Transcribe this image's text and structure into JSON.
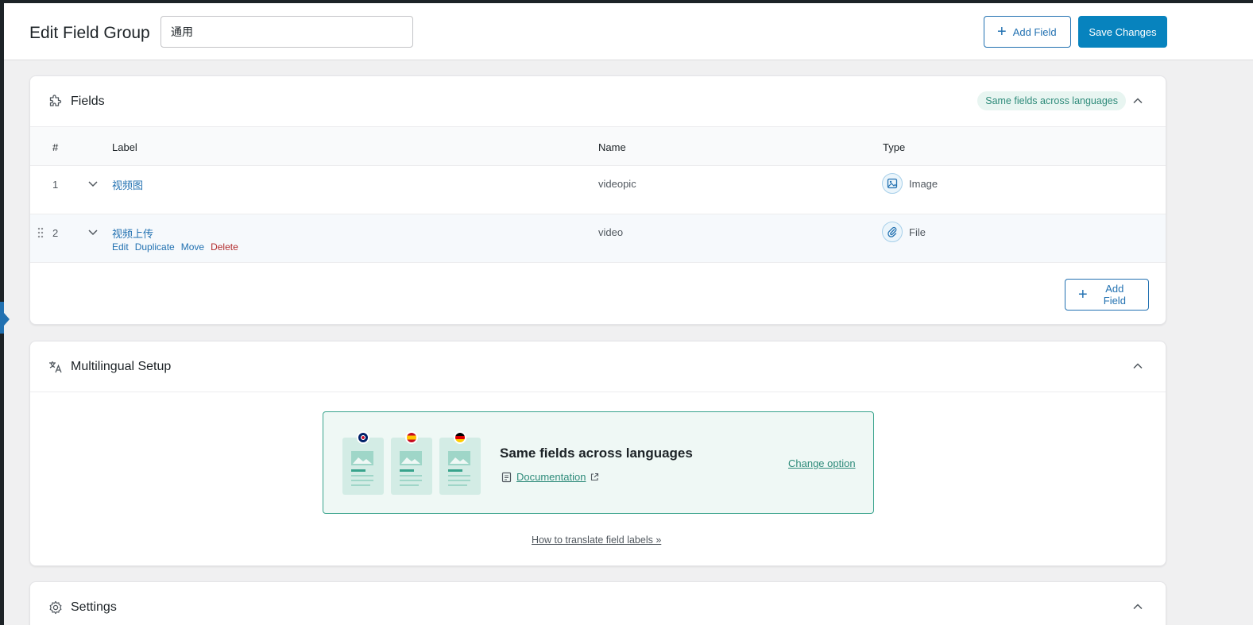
{
  "header": {
    "page_title": "Edit Field Group",
    "group_title_value": "通用",
    "add_field_label": "Add Field",
    "save_label": "Save Changes"
  },
  "fields_panel": {
    "title": "Fields",
    "badge": "Same fields across languages",
    "columns": {
      "num": "#",
      "label": "Label",
      "name": "Name",
      "type": "Type"
    },
    "rows": [
      {
        "num": "1",
        "label": "视频图",
        "name": "videopic",
        "type": "Image",
        "type_icon": "image-icon"
      },
      {
        "num": "2",
        "label": "视频上传",
        "name": "video",
        "type": "File",
        "type_icon": "paperclip-icon",
        "actions": {
          "edit": "Edit",
          "duplicate": "Duplicate",
          "move": "Move",
          "delete": "Delete"
        }
      }
    ],
    "add_field_label": "Add Field"
  },
  "multilingual_panel": {
    "title": "Multilingual Setup",
    "card_title": "Same fields across languages",
    "documentation": "Documentation",
    "change_option": "Change option",
    "how_to": "How to translate field labels »"
  },
  "settings_panel": {
    "title": "Settings"
  },
  "colors": {
    "primary": "#0783be",
    "link": "#2271b1",
    "delete": "#b32d2e",
    "teal": "#2e8b7a"
  }
}
